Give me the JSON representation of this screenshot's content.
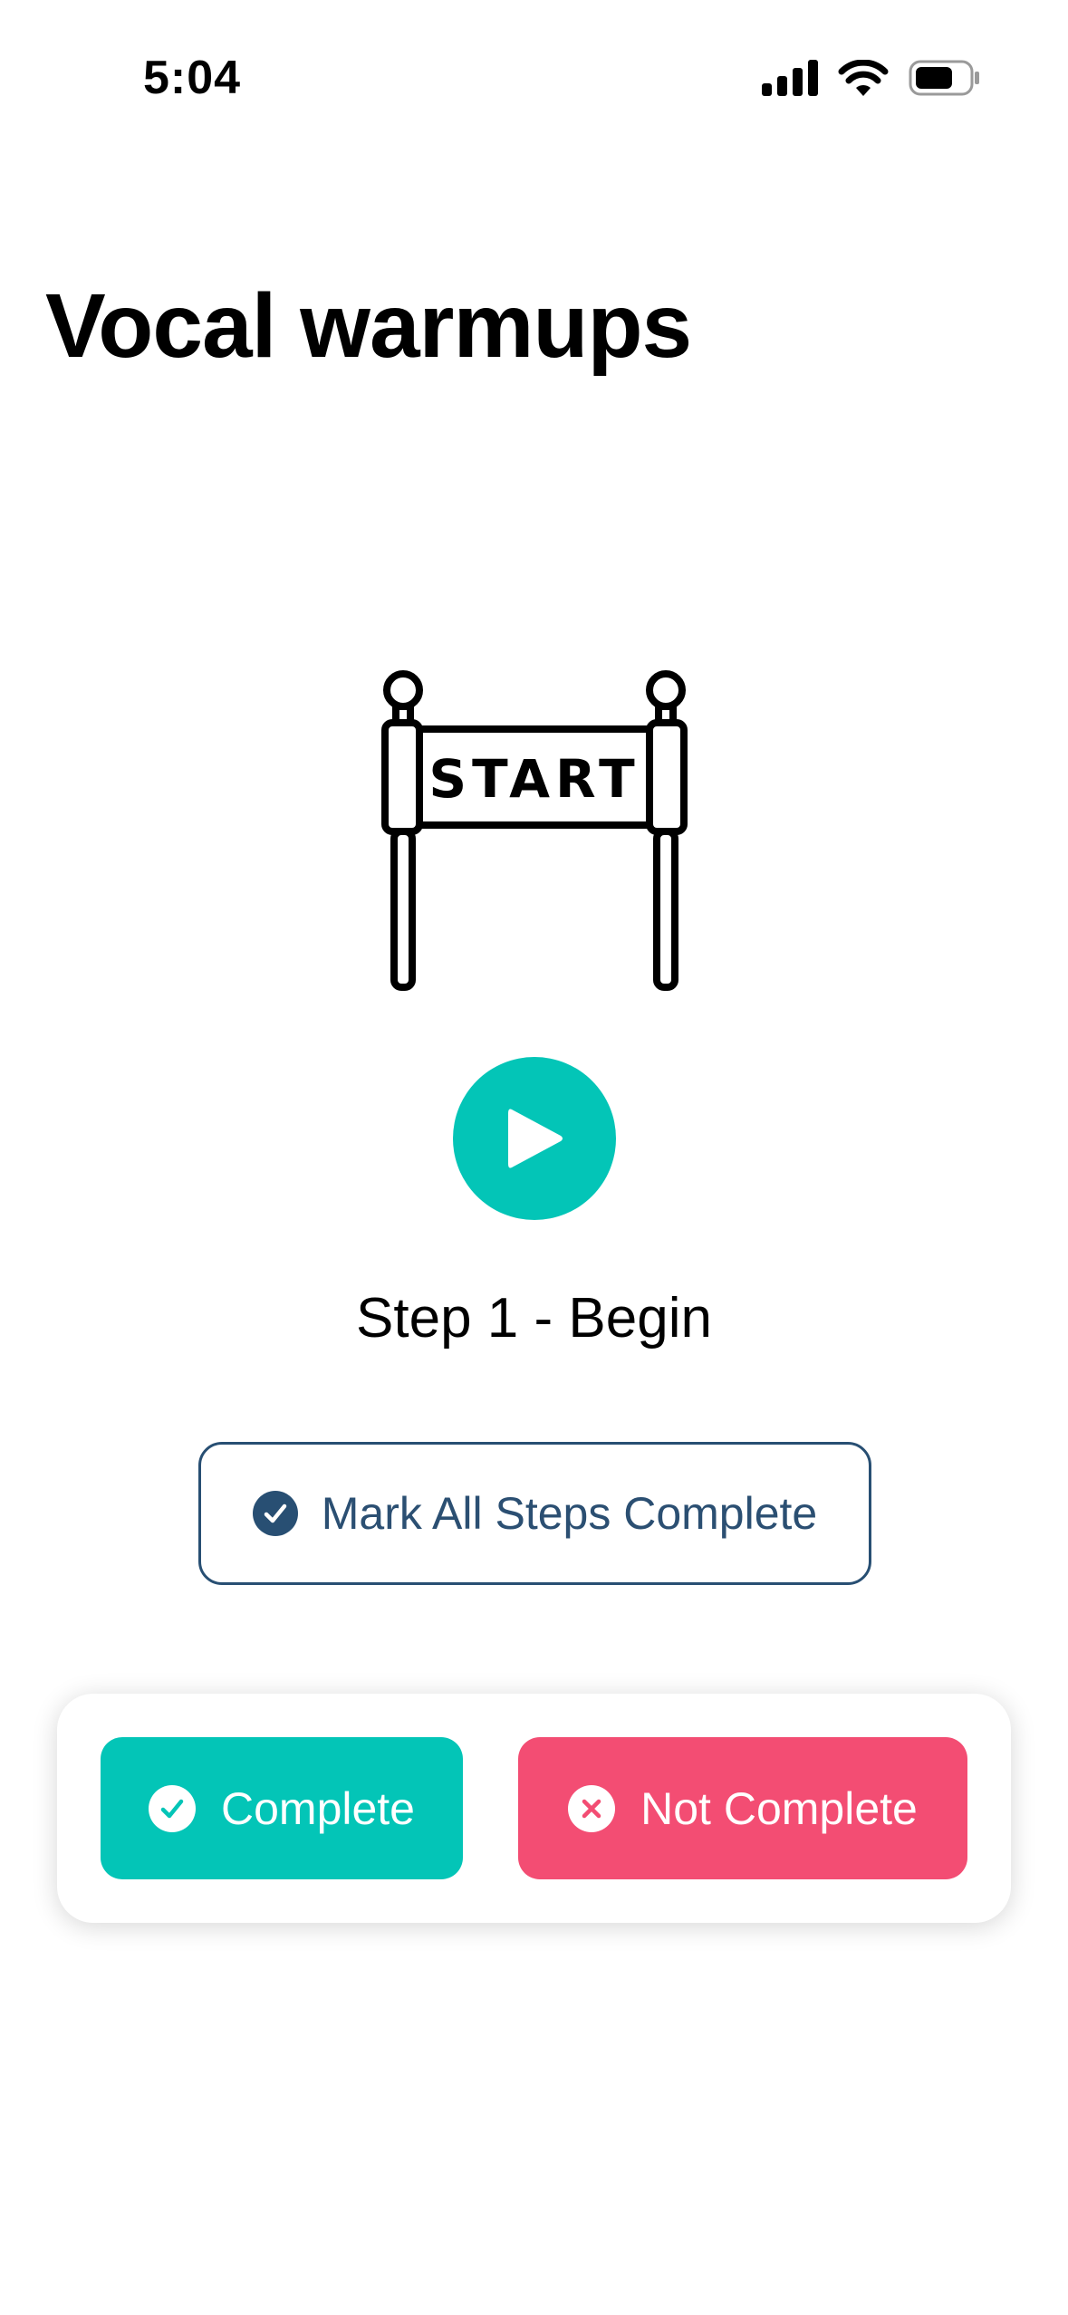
{
  "status_bar": {
    "time": "5:04",
    "icons": [
      "cellular-signal-icon",
      "wifi-icon",
      "battery-icon"
    ]
  },
  "header": {
    "title": "Vocal warmups"
  },
  "illustration": {
    "icon": "start-banner-icon",
    "banner_text": "START"
  },
  "player": {
    "icon": "play-icon",
    "step_label": "Step 1 - Begin"
  },
  "mark_all": {
    "label": "Mark All Steps Complete",
    "icon": "check-circle-icon"
  },
  "actions": {
    "complete_label": "Complete",
    "complete_icon": "check-circle-icon",
    "not_complete_label": "Not Complete",
    "not_complete_icon": "x-circle-icon"
  },
  "colors": {
    "teal": "#03c5b7",
    "pink": "#f34d73",
    "navy": "#284f73",
    "text": "#000000"
  }
}
